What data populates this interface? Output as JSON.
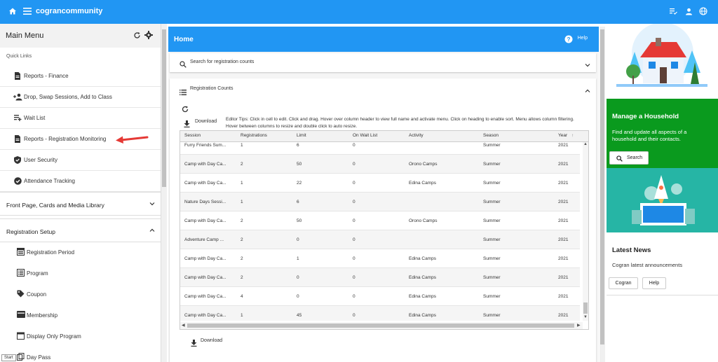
{
  "topbar": {
    "brand": "cograncommunity"
  },
  "sidebar": {
    "title": "Main Menu",
    "quick_links_label": "Quick Links",
    "quick_links": [
      {
        "label": "Reports - Finance"
      },
      {
        "label": "Drop, Swap Sessions, Add to Class"
      },
      {
        "label": "Wait List"
      },
      {
        "label": "Reports - Registration Monitoring"
      },
      {
        "label": "User Security"
      },
      {
        "label": "Attendance Tracking"
      }
    ],
    "sections": [
      {
        "label": "Front Page, Cards and Media Library"
      },
      {
        "label": "Registration Setup"
      }
    ],
    "setup_items": [
      {
        "label": "Registration Period"
      },
      {
        "label": "Program"
      },
      {
        "label": "Coupon"
      },
      {
        "label": "Membership"
      },
      {
        "label": "Display Only Program"
      },
      {
        "label": "Day Pass"
      }
    ],
    "start_label": "Start"
  },
  "main": {
    "home_title": "Home",
    "help_label": "Help",
    "search_label": "Search for registration counts",
    "counts_label": "Registration Counts",
    "download_label": "Download",
    "tips": "Editor Tips: Click in cell to edit. Click and drag. Hover over column header to view full name and activate menu. Click on heading to enable sort. Menu allows column filtering. Hover between columns to resize and double click to auto resize.",
    "bottom_download_label": "Download",
    "columns": [
      "Session",
      "Registrations",
      "Limit",
      "On Wait List",
      "Activity",
      "Season",
      "Year"
    ],
    "rows": [
      [
        "Furry Friends Sum...",
        "1",
        "6",
        "0",
        "",
        "Summer",
        "2021"
      ],
      [
        "Camp with Day Ca...",
        "2",
        "50",
        "0",
        "Orono Camps",
        "Summer",
        "2021"
      ],
      [
        "Camp with Day Ca...",
        "1",
        "22",
        "0",
        "Edina Camps",
        "Summer",
        "2021"
      ],
      [
        "Nature Days Sessi...",
        "1",
        "6",
        "0",
        "",
        "Summer",
        "2021"
      ],
      [
        "Camp with Day Ca...",
        "2",
        "50",
        "0",
        "Orono Camps",
        "Summer",
        "2021"
      ],
      [
        "Adventure Camp ...",
        "2",
        "0",
        "0",
        "",
        "Summer",
        "2021"
      ],
      [
        "Camp with Day Ca...",
        "2",
        "1",
        "0",
        "Edina Camps",
        "Summer",
        "2021"
      ],
      [
        "Camp with Day Ca...",
        "2",
        "0",
        "0",
        "Edina Camps",
        "Summer",
        "2021"
      ],
      [
        "Camp with Day Ca...",
        "4",
        "0",
        "0",
        "Edina Camps",
        "Summer",
        "2021"
      ],
      [
        "Camp with Day Ca...",
        "1",
        "45",
        "0",
        "Edina Camps",
        "Summer",
        "2021"
      ]
    ]
  },
  "right": {
    "household_title": "Manage a Household",
    "household_text": "Find and update all aspects of a household and their contacts.",
    "search_button": "Search",
    "news_title": "Latest News",
    "news_text": "Cogran latest announcements",
    "cogran_button": "Cogran",
    "help_button": "Help",
    "colors": {
      "green": "#0a9a1e",
      "teal": "#26b5a5",
      "blue": "#2196f3"
    }
  }
}
